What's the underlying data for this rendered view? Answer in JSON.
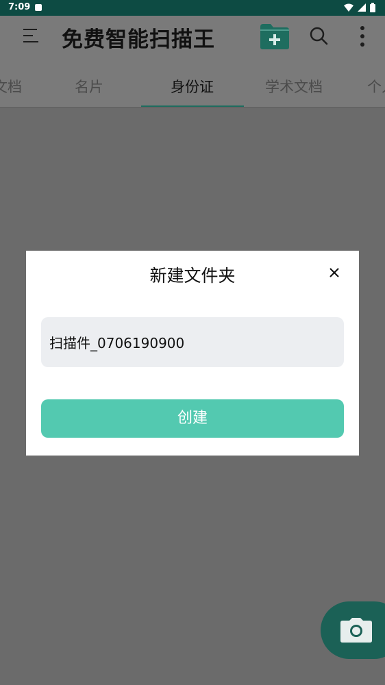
{
  "status_bar": {
    "time": "7:09",
    "icons": [
      "notification-icon",
      "wifi-icon",
      "signal-icon",
      "battery-icon"
    ]
  },
  "app_bar": {
    "title": "免费智能扫描王",
    "icons": [
      "menu-icon",
      "new-folder-icon",
      "search-icon",
      "more-vert-icon"
    ]
  },
  "tabs": [
    {
      "label": "文档"
    },
    {
      "label": "名片"
    },
    {
      "label": "身份证",
      "active": true
    },
    {
      "label": "学术文档"
    },
    {
      "label": "个人"
    }
  ],
  "dialog": {
    "title": "新建文件夹",
    "input_value": "扫描件_0706190900",
    "create_label": "创建"
  },
  "fab": {
    "icon": "camera-icon"
  },
  "colors": {
    "status_bar": "#0d4b43",
    "accent": "#53c9b0",
    "tab_indicator": "#1e6d5f",
    "fab": "#1b6156"
  }
}
